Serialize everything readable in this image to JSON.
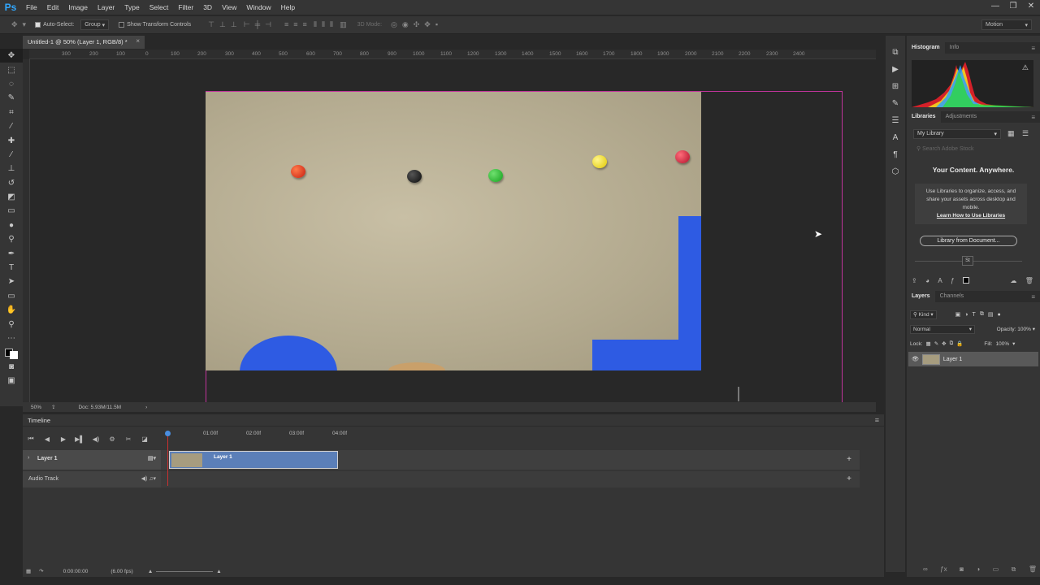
{
  "app": {
    "logo": "Ps",
    "menu": [
      "File",
      "Edit",
      "Image",
      "Layer",
      "Type",
      "Select",
      "Filter",
      "3D",
      "View",
      "Window",
      "Help"
    ],
    "window_controls": [
      "—",
      "❐",
      "✕"
    ]
  },
  "options_bar": {
    "auto_select_label": "Auto-Select:",
    "auto_select_value": "Group",
    "show_transform_label": "Show Transform Controls",
    "mode_3d_label": "3D Mode:",
    "workspace": "Motion"
  },
  "document": {
    "tab_title": "Untitled-1 @ 50% (Layer 1, RGB/8) *",
    "zoom": "50%",
    "doc_size": "Doc: 5.93M/11.5M",
    "ruler_ticks": [
      "300",
      "200",
      "100",
      "0",
      "100",
      "200",
      "300",
      "400",
      "500",
      "600",
      "700",
      "800",
      "900",
      "1000",
      "1100",
      "1200",
      "1300",
      "1400",
      "1500",
      "1600",
      "1700",
      "1800",
      "1900",
      "2000",
      "2100",
      "2200",
      "2300",
      "2400"
    ]
  },
  "timeline": {
    "title": "Timeline",
    "ticks": [
      "01:00f",
      "02:00f",
      "03:00f",
      "04:00f"
    ],
    "layer_track": "Layer 1",
    "clip_label": "Layer 1",
    "audio_track": "Audio Track",
    "timecode": "0:00:00:00",
    "fps": "(6.00 fps)"
  },
  "panels": {
    "top_tabs": [
      "Histogram",
      "Info"
    ],
    "lib_tabs": [
      "Libraries",
      "Adjustments"
    ],
    "library_select": "My Library",
    "search_placeholder": "Search Adobe Stock",
    "lib_heading": "Your Content. Anywhere.",
    "lib_body": "Use Libraries to organize, access, and share your assets across desktop and mobile.",
    "lib_link": "Learn How to Use Libraries",
    "lib_button": "Library from Document...",
    "lib_counter": "St",
    "layer_tabs": [
      "Layers",
      "Channels"
    ],
    "kind_label": "Kind",
    "blend_mode": "Normal",
    "opacity_label": "Opacity:",
    "opacity_value": "100%",
    "lock_label": "Lock:",
    "fill_label": "Fill:",
    "fill_value": "100%",
    "layer_name": "Layer 1"
  },
  "colors": {
    "accent": "#31a8ff",
    "artboard_border": "#c0349b",
    "clip": "#5b7fb8"
  }
}
